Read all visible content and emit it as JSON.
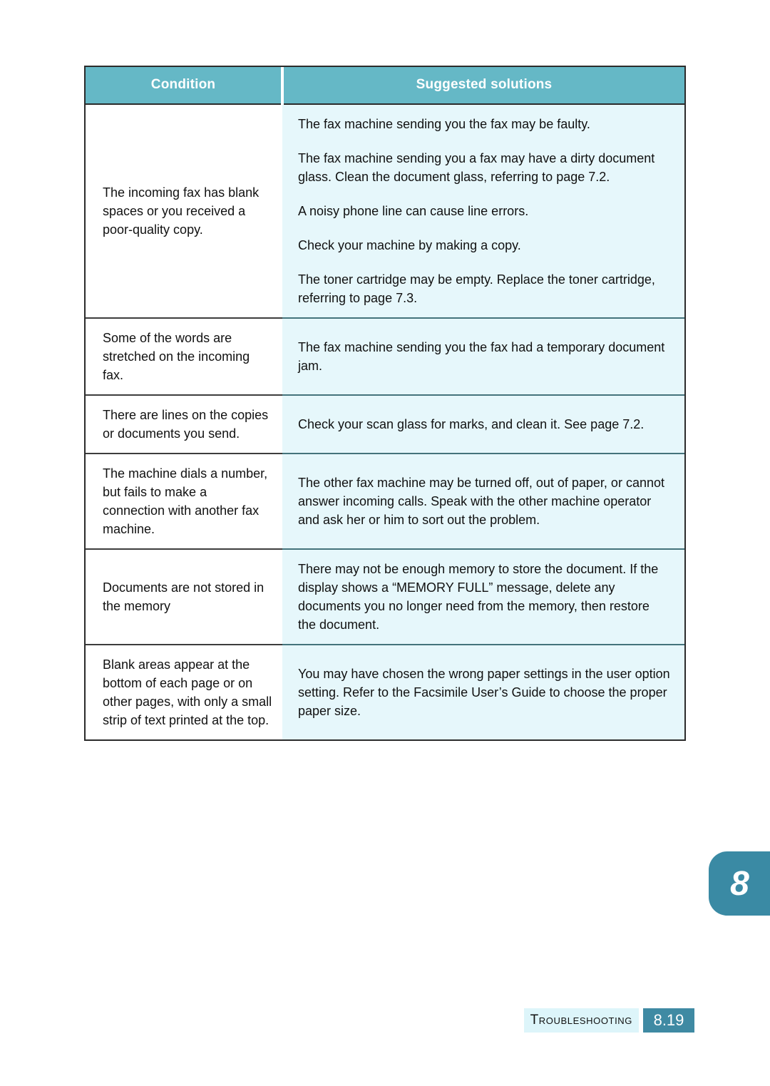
{
  "page": {
    "chapter_tab_number": "8",
    "colors": {
      "header_teal": "#65b8c6",
      "solution_cell_bg": "#e6f7fb",
      "tab_teal": "#3a8aa4",
      "footer_name_bg": "#ddf5fa",
      "footer_number_bg": "#3f8aa3",
      "border": "#2b2b2b"
    }
  },
  "table": {
    "headers": {
      "condition": "Condition",
      "solutions": "Suggested solutions"
    },
    "rows": [
      {
        "condition": "The incoming fax has blank spaces or you received a poor-quality copy.",
        "solutions": [
          "The fax machine sending you the fax may be faulty.",
          "The fax machine sending you a fax may have a dirty document glass. Clean the document glass, referring to page 7.2.",
          "A noisy phone line can cause line errors.",
          "Check your machine by making a copy.",
          "The toner cartridge may be empty. Replace the toner cartridge, referring to page 7.3."
        ]
      },
      {
        "condition": "Some of the words are stretched on the incoming fax.",
        "solutions": [
          "The fax machine sending you the fax had a temporary document jam."
        ]
      },
      {
        "condition": "There are lines on the copies or documents you send.",
        "solutions": [
          "Check your scan glass for marks, and clean it. See page 7.2."
        ]
      },
      {
        "condition": "The machine dials a number, but fails to make a connection with another fax machine.",
        "solutions": [
          "The other fax machine may be turned off, out of paper, or cannot answer incoming calls. Speak with the other machine operator and ask her or him to sort out the problem."
        ]
      },
      {
        "condition": "Documents are not stored in the memory",
        "solutions": [
          "There may not be enough memory to store the document. If the display shows a “MEMORY FULL” message, delete any documents you no longer need from the memory, then restore the document."
        ]
      },
      {
        "condition": "Blank areas appear at the bottom of each page or on other pages, with only a small strip of text printed at the top.",
        "solutions": [
          "You may have chosen the wrong paper settings in the user option setting. Refer to the Facsimile User’s Guide to choose the proper paper size."
        ]
      }
    ]
  },
  "footer": {
    "chapter_name": "Troubleshooting",
    "page_number": "8.19"
  }
}
